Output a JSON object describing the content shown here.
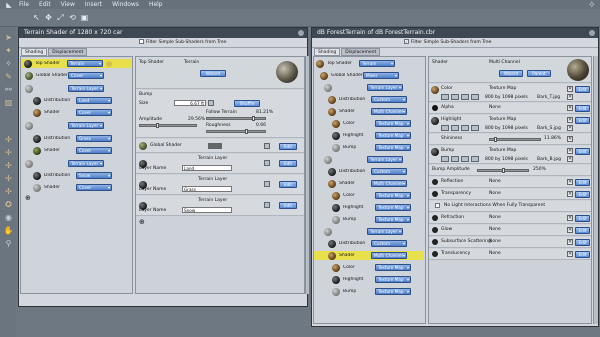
{
  "menubar": {
    "logo_icon": "poser-logo-icon",
    "items": [
      "File",
      "Edit",
      "View",
      "Insert",
      "Windows",
      "Help"
    ]
  },
  "left_window": {
    "title": "Terrain Shader of 1280 x 720 car",
    "filter_label": "Filter Simple Sub-Shaders from Tree",
    "tabs": [
      "Shading",
      "Displacement"
    ],
    "tree": [
      {
        "label": "Top Shader",
        "value": "Terrain",
        "selected": true
      },
      {
        "label": "Global Shader",
        "value": "Cover"
      },
      {
        "label": "",
        "value": "Terrain Layer"
      },
      {
        "label": "Distribution",
        "value": "Land"
      },
      {
        "label": "Shader",
        "value": "Cover"
      },
      {
        "label": "",
        "value": "Terrain Layer"
      },
      {
        "label": "Distribution",
        "value": "Grass"
      },
      {
        "label": "Shader",
        "value": "Cover"
      },
      {
        "label": "",
        "value": "Terrain Layer"
      },
      {
        "label": "Distribution",
        "value": "Snow"
      },
      {
        "label": "Shader",
        "value": "Cover"
      }
    ],
    "props": {
      "header_left": "Top Shader",
      "header_right": "Terrain",
      "wizard_label": "Wizard",
      "bump_label": "Bump",
      "size_label": "Size",
      "size_value": "6.67 ft",
      "shuffle_label": "Shuffle",
      "follow_terrain_label": "Follow Terrain",
      "follow_terrain_value": "81.21%",
      "amplitude_label": "Amplitude",
      "amplitude_value": "29.56%",
      "roughness_label": "Roughness",
      "roughness_value": "0.66",
      "global_shader_label": "Global Shader",
      "edit_label": "Edit",
      "layers": [
        {
          "type": "Terrain Layer",
          "name_label": "Layer Name",
          "name": "Land"
        },
        {
          "type": "Terrain Layer",
          "name_label": "Layer Name",
          "name": "Grass"
        },
        {
          "type": "Terrain Layer",
          "name_label": "Layer Name",
          "name": "Snow"
        }
      ]
    }
  },
  "right_window": {
    "title": "dB ForestTerrain of dB ForestTerrain.cbr",
    "filter_label": "Filter Simple Sub-Shaders from Tree",
    "tabs": [
      "Shading",
      "Displacement"
    ],
    "tree": [
      {
        "label": "Top Shader",
        "value": "Terrain"
      },
      {
        "label": "Global Shader",
        "value": "Mixer"
      },
      {
        "label": "",
        "value": "Terrain Layer"
      },
      {
        "label": "Distribution",
        "value": "Custom"
      },
      {
        "label": "Shader",
        "value": "Multi Channel"
      },
      {
        "label": "Color",
        "value": "Texture Map"
      },
      {
        "label": "Highlight",
        "value": "Texture Map"
      },
      {
        "label": "Bump",
        "value": "Texture Map"
      },
      {
        "label": "",
        "value": "Terrain Layer"
      },
      {
        "label": "Distribution",
        "value": "Custom"
      },
      {
        "label": "Shader",
        "value": "Multi Channel"
      },
      {
        "label": "Color",
        "value": "Texture Map"
      },
      {
        "label": "Highlight",
        "value": "Texture Map"
      },
      {
        "label": "Bump",
        "value": "Texture Map"
      },
      {
        "label": "",
        "value": "Terrain Layer"
      },
      {
        "label": "Distribution",
        "value": "Custom"
      },
      {
        "label": "Shader",
        "value": "Multi Channel",
        "selected": true
      },
      {
        "label": "Color",
        "value": "Texture Map"
      },
      {
        "label": "Highlight",
        "value": "Texture Map"
      },
      {
        "label": "Bump",
        "value": "Texture Map"
      }
    ],
    "props": {
      "header_left": "Shader",
      "header_right": "Multi Channel",
      "wizard_label": "Wizard",
      "parent_label": "Parent",
      "edit_label": "Edit",
      "channels": [
        {
          "name": "Color",
          "value": "Texture Map",
          "info": "800 by 1098 pixels",
          "file": "Bark_T.jpg"
        },
        {
          "name": "Alpha",
          "value": "None"
        },
        {
          "name": "Highlight",
          "value": "Texture Map",
          "info": "800 by 1098 pixels",
          "file": "Bark_S.jpg"
        },
        {
          "name": "Shininess",
          "value": "11.86%"
        },
        {
          "name": "Bump",
          "value": "Texture Map",
          "info": "800 by 1098 pixels",
          "file": "Bark_B.jpg"
        },
        {
          "name": "Bump Amplitude",
          "value": "250%"
        },
        {
          "name": "Reflection",
          "value": "None"
        },
        {
          "name": "Transparency",
          "value": "None"
        },
        {
          "name": "No Light Interactions When Fully Transparent",
          "value": ""
        },
        {
          "name": "Refraction",
          "value": "None"
        },
        {
          "name": "Glow",
          "value": "None"
        },
        {
          "name": "Subsurface Scattering",
          "value": "None"
        },
        {
          "name": "Translucency",
          "value": "None"
        }
      ]
    }
  }
}
